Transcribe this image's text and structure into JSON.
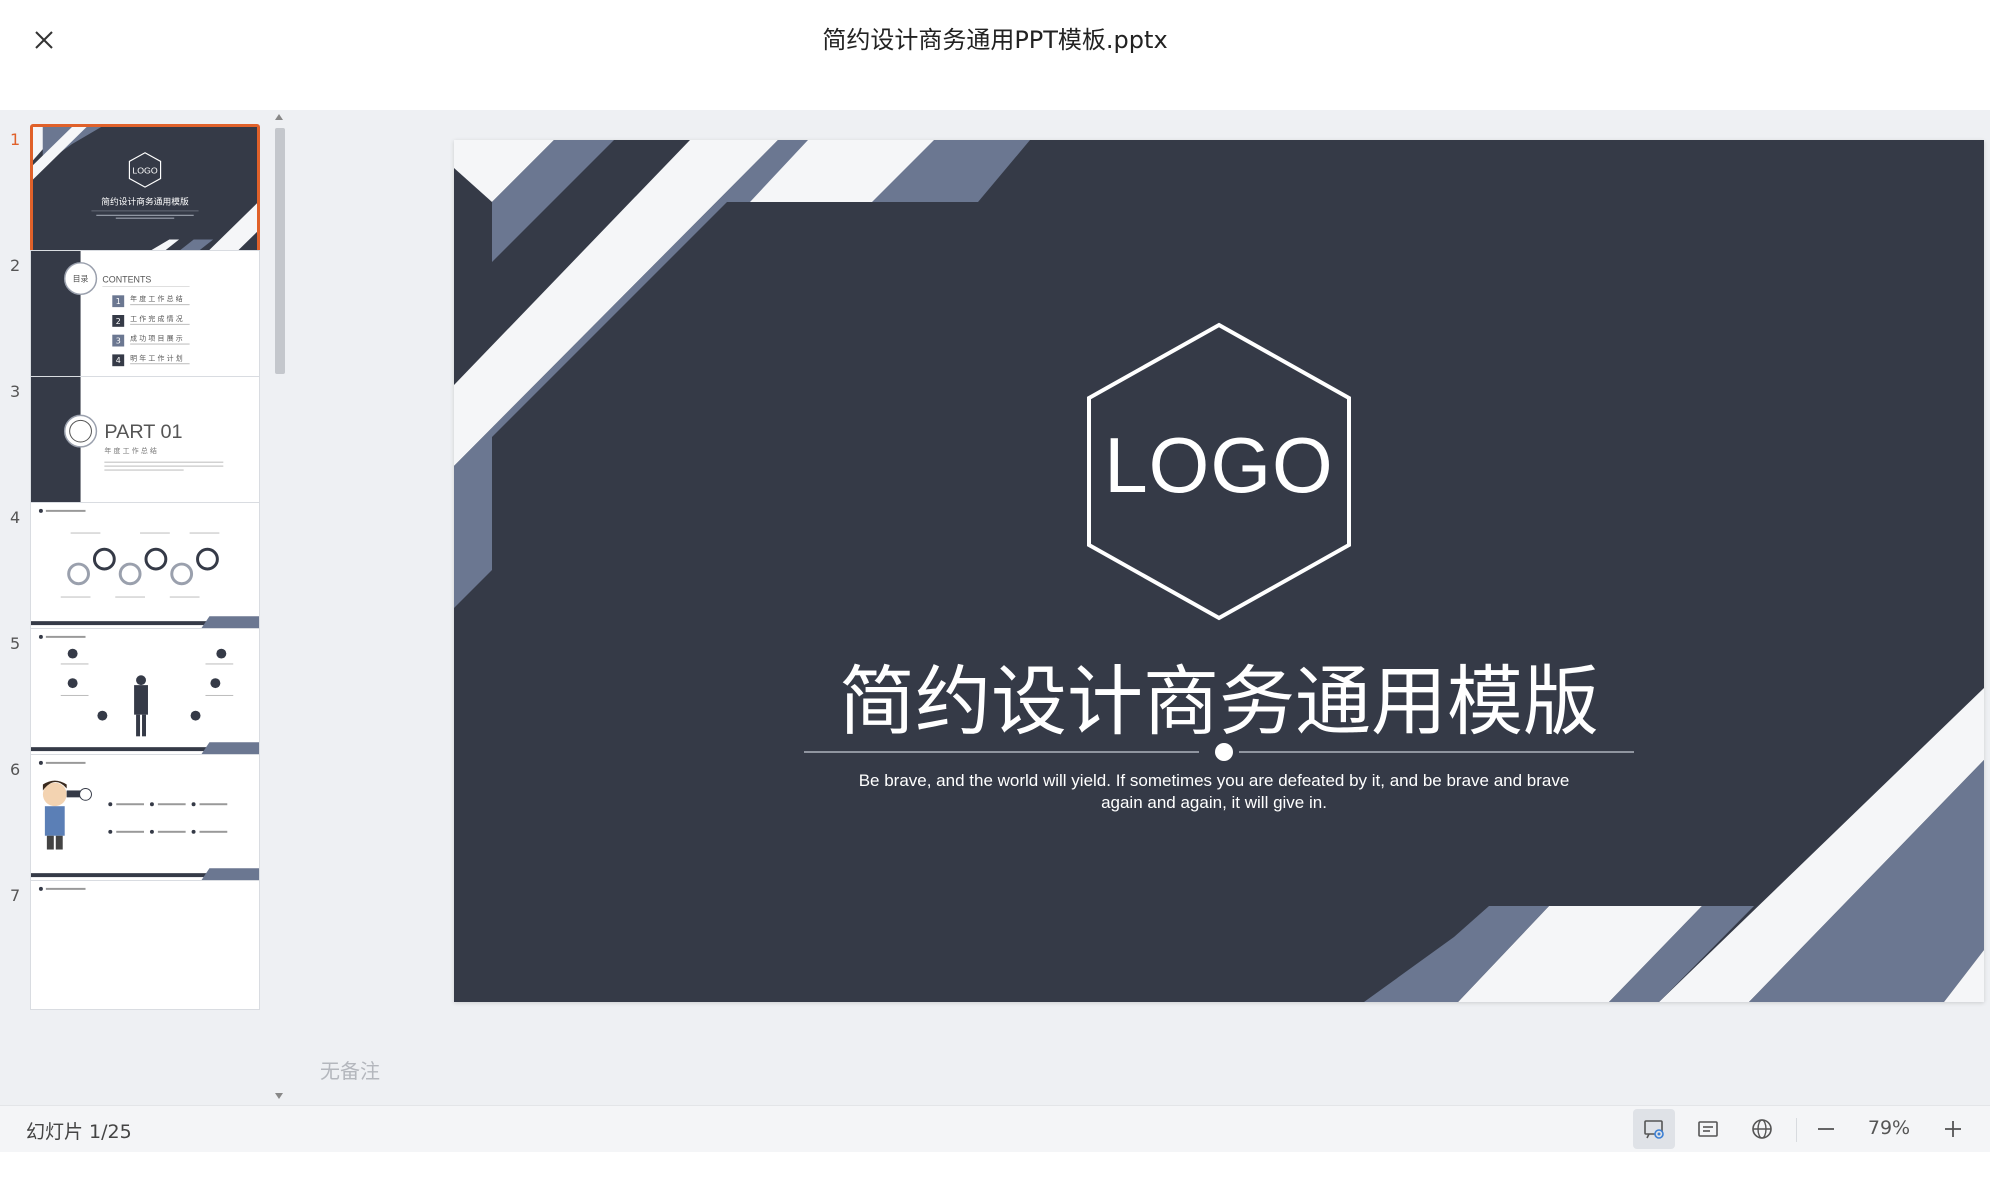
{
  "window": {
    "title": "简约设计商务通用PPT模板.pptx"
  },
  "thumbnails": [
    {
      "number": "1",
      "active": true
    },
    {
      "number": "2",
      "active": false,
      "heading": "CONTENTS",
      "badge": "目录",
      "items": [
        "年 度 工 作 总 结",
        "工 作 完 成 情 况",
        "成 功 项 目 展 示",
        "明 年 工 作 计 划"
      ]
    },
    {
      "number": "3",
      "active": false,
      "heading": "PART 01",
      "subheading": "年 度 工 作 总 结"
    },
    {
      "number": "4",
      "active": false
    },
    {
      "number": "5",
      "active": false
    },
    {
      "number": "6",
      "active": false
    },
    {
      "number": "7",
      "active": false
    }
  ],
  "slide": {
    "logo": "LOGO",
    "title": "简约设计商务通用模版",
    "subtitle": "Be brave, and the world will yield. If sometimes you are defeated by it, and be brave and brave again and again, it will give in.",
    "colors": {
      "background": "#353a47",
      "accent": "#6b7791",
      "light": "#f5f6f8"
    }
  },
  "notes": {
    "placeholder": "无备注"
  },
  "status": {
    "slide_counter": "幻灯片 1/25",
    "zoom": "79%"
  },
  "toolbar": {
    "icons": [
      "presenter-view-icon",
      "notes-view-icon",
      "web-view-icon",
      "zoom-out-icon",
      "zoom-in-icon"
    ]
  }
}
